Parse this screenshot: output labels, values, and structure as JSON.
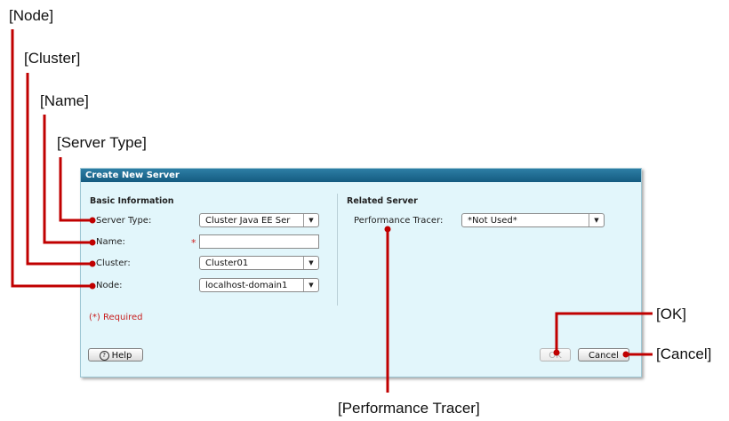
{
  "callouts": {
    "node": "[Node]",
    "cluster": "[Cluster]",
    "name": "[Name]",
    "server_type": "[Server Type]",
    "performance_tracer": "[Performance Tracer]",
    "ok": "[OK]",
    "cancel": "[Cancel]"
  },
  "dialog": {
    "title": "Create New Server",
    "basic_section": "Basic Information",
    "related_section": "Related Server",
    "server_type_label": "Server Type:",
    "server_type_value": "Cluster Java EE Ser",
    "name_label": "Name:",
    "name_value": "",
    "required_star": "*",
    "cluster_label": "Cluster:",
    "cluster_value": "Cluster01",
    "node_label": "Node:",
    "node_value": "localhost-domain1",
    "perf_tracer_label": "Performance Tracer:",
    "perf_tracer_value": "*Not Used*",
    "required_note": "(*) Required",
    "help_label": "Help",
    "ok_label": "OK",
    "cancel_label": "Cancel",
    "dropdown_glyph": "▼",
    "help_glyph": "?"
  },
  "colors": {
    "titlebar": "#1d6a91",
    "dialog_bg": "#e2f6fb",
    "callout_line": "#c00000",
    "required": "#c81e1e"
  }
}
